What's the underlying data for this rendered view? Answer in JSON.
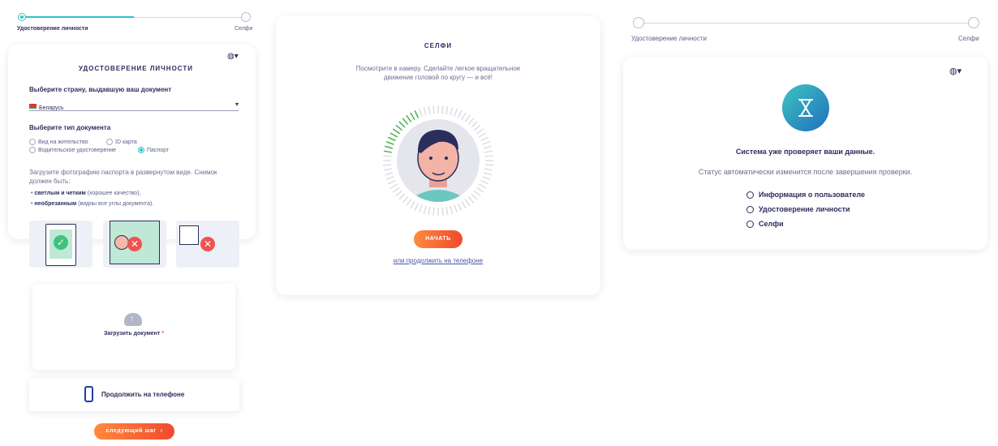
{
  "left": {
    "stepper": {
      "step1": "Удостоверение личности",
      "step2": "Селфи"
    },
    "title": "УДОСТОВЕРЕНИЕ ЛИЧНОСТИ",
    "lang_icon": "globe-icon",
    "country_label": "Выберите страну, выдавшую ваш документ",
    "country_value": "Беларусь",
    "doctype_label": "Выберите тип документа",
    "doctypes": [
      "Вид на жительство",
      "ID карта",
      "Водительское удостоверение",
      "Паспорт"
    ],
    "selected_doctype": "Паспорт",
    "instructions": "Загрузите фотографию паспорта в развернутом виде. Снимок должен быть:",
    "bullet1_bold": "светлым и четким",
    "bullet1_rest": " (хорошее качество),",
    "bullet2_bold": "необрезанным",
    "bullet2_rest": " (видны все углы документа).",
    "upload_label": "Загрузить документ",
    "required_mark": "*",
    "continue_phone": "Продолжить на телефоне",
    "next_step": "следующий шаг",
    "next_arrow": "›"
  },
  "middle": {
    "title": "СЕЛФИ",
    "instruction_line1": "Посмотрите в камеру. Сделайте легкое вращательное",
    "instruction_line2": "движение головой по кругу — и всё!",
    "start_button": "НАЧАТЬ",
    "phone_link": "или продолжить на телефоне"
  },
  "right": {
    "stepper": {
      "step1": "Удостоверение личности",
      "step2": "Селфи"
    },
    "heading": "Система уже проверяет ваши данные.",
    "subtext": "Статус автоматически изменится после завершения проверки.",
    "statuses": [
      "Информация о пользователе",
      "Удостоверение личности",
      "Селфи"
    ]
  },
  "colors": {
    "accent": "#35c0c8",
    "orange_start": "#ff8a3d",
    "orange_end": "#f1492e",
    "text": "#2b2d5c"
  }
}
